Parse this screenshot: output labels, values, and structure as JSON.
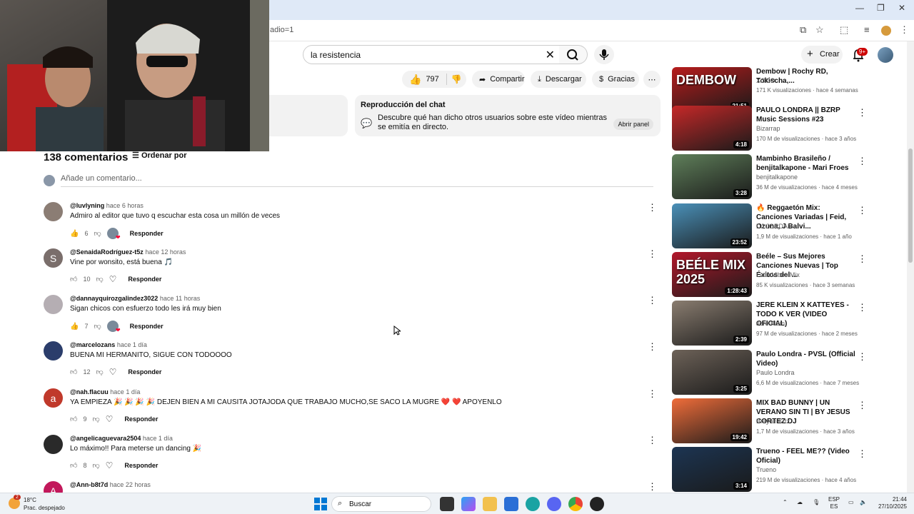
{
  "browser": {
    "url_fragment": "adio=1",
    "window_controls": [
      "—",
      "❐",
      "✕"
    ]
  },
  "header": {
    "search_query": "la resistencia",
    "create_label": "Crear",
    "notifications_badge": "9+"
  },
  "actions": {
    "likes": "797",
    "share_label": "Compartir",
    "download_label": "Descargar",
    "thanks_label": "Gracias"
  },
  "chat_replay": {
    "title": "Reproducción del chat",
    "description": "Descubre qué han dicho otros usuarios sobre este vídeo mientras se emitía en directo.",
    "open_label": "Abrir panel"
  },
  "comments": {
    "count_label": "138 comentarios",
    "sort_label": "Ordenar por",
    "add_placeholder": "Añade un comentario...",
    "reply_label": "Responder",
    "items": [
      {
        "author": "@luvlyning",
        "time": "hace 6 horas",
        "text": "Admiro al editor que tuvo q escuchar esta cosa un millón de veces",
        "likes": "6",
        "avatar_letter": "",
        "avatar_color": "#8b7d74",
        "liked": true,
        "creator_heart": true
      },
      {
        "author": "@SenaidaRodríguez-t5z",
        "time": "hace 12 horas",
        "text": "Vine por wonsito, está buena 🎵",
        "likes": "10",
        "avatar_letter": "S",
        "avatar_color": "#7a6e6b",
        "liked": false,
        "creator_heart": false
      },
      {
        "author": "@dannayquirozgalindez3022",
        "time": "hace 11 horas",
        "text": "Sigan chicos con esfuerzo todo les irá muy bien",
        "likes": "7",
        "avatar_letter": "",
        "avatar_color": "#b5aeb3",
        "liked": true,
        "creator_heart": true
      },
      {
        "author": "@marcelozans",
        "time": "hace 1 día",
        "text": "BUENA MI HERMANITO, SIGUE CON TODOOOO",
        "likes": "12",
        "avatar_letter": "",
        "avatar_color": "#2b3d6b",
        "liked": false,
        "creator_heart": false
      },
      {
        "author": "@nah.flacuu",
        "time": "hace 1 día",
        "text": "YA EMPIEZA 🎉 🎉 🎉 🎉 DEJEN BIEN A MI CAUSITA JOTAJODA QUE TRABAJO MUCHO,SE SACO LA MUGRE ❤️ ❤️ APOYENLO",
        "likes": "9",
        "avatar_letter": "a",
        "avatar_color": "#c0392b",
        "liked": false,
        "creator_heart": false
      },
      {
        "author": "@angelicaguevara2504",
        "time": "hace 1 día",
        "text": "Lo máximo!! Para meterse un dancing 🎉",
        "likes": "8",
        "avatar_letter": "",
        "avatar_color": "#2a2a2a",
        "liked": false,
        "creator_heart": false
      },
      {
        "author": "@Ann-b8t7d",
        "time": "hace 22 horas",
        "text": "",
        "likes": "",
        "avatar_letter": "A",
        "avatar_color": "#c2185b",
        "liked": false,
        "creator_heart": false
      }
    ]
  },
  "sidebar": {
    "items": [
      {
        "title": "Dembow | Rochy RD, Tokischa,...",
        "channel": "XOCO",
        "stats": "171 K visualizaciones · hace 4 semanas",
        "duration": "21:51",
        "thumb_text": "DEMBOW",
        "thumb_color": "#b71c1c"
      },
      {
        "title": "PAULO LONDRA || BZRP Music Sessions #23",
        "channel": "Bizarrap",
        "stats": "170 M de visualizaciones · hace 3 años",
        "duration": "4:18",
        "thumb_text": "",
        "thumb_color": "#c62828"
      },
      {
        "title": "Mambinho Brasileño / benjitalkapone - Mari Froes",
        "channel": "benjitalkapone",
        "stats": "36 M de visualizaciones · hace 4 meses",
        "duration": "3:28",
        "thumb_text": "",
        "thumb_color": "#5f7f5a"
      },
      {
        "title": "🔥 Reggaetón Mix: Canciones Variadas | Feid, Ozuna, J Balvi...",
        "channel": "DJ JORDAN",
        "stats": "1,9 M de visualizaciones · hace 1 año",
        "duration": "23:52",
        "thumb_text": "",
        "thumb_color": "#4a90b8"
      },
      {
        "title": "Beéle – Sus Mejores Canciones Nuevas | Top Éxitos del ...",
        "channel": "Latin Vibes Mix",
        "stats": "85 K visualizaciones · hace 3 semanas",
        "duration": "1:28:43",
        "thumb_text": "BEÉLE MIX 2025",
        "thumb_color": "#b2182b"
      },
      {
        "title": "JERE KLEIN X KATTEYES - TODO K VER (VIDEO OFICIAL)",
        "channel": "Jere Klein",
        "stats": "97 M de visualizaciones · hace 2 meses",
        "duration": "2:39",
        "thumb_text": "",
        "thumb_color": "#8a7d70"
      },
      {
        "title": "Paulo Londra - PVSL (Official Video)",
        "channel": "Paulo Londra",
        "stats": "6,6 M de visualizaciones · hace 7 meses",
        "duration": "3:25",
        "thumb_text": "",
        "thumb_color": "#6d6258"
      },
      {
        "title": "MIX BAD BUNNY | UN VERANO SIN TI | BY JESUS CORTEZ DJ",
        "channel": "Brayan Krtz",
        "stats": "1,7 M de visualizaciones · hace 3 años",
        "duration": "19:42",
        "thumb_text": "",
        "thumb_color": "#f06d3a"
      },
      {
        "title": "Trueno - FEEL ME?? (Video Oficial)",
        "channel": "Trueno",
        "stats": "219 M de visualizaciones · hace 4 años",
        "duration": "3:14",
        "thumb_text": "",
        "thumb_color": "#1c3553"
      }
    ]
  },
  "taskbar": {
    "weather_temp": "18°C",
    "weather_desc": "Prac. despejado",
    "weather_badge": "2",
    "search_label": "Buscar",
    "lang_top": "ESP",
    "lang_bottom": "ES",
    "time": "21:44",
    "date": "27/10/2025"
  }
}
